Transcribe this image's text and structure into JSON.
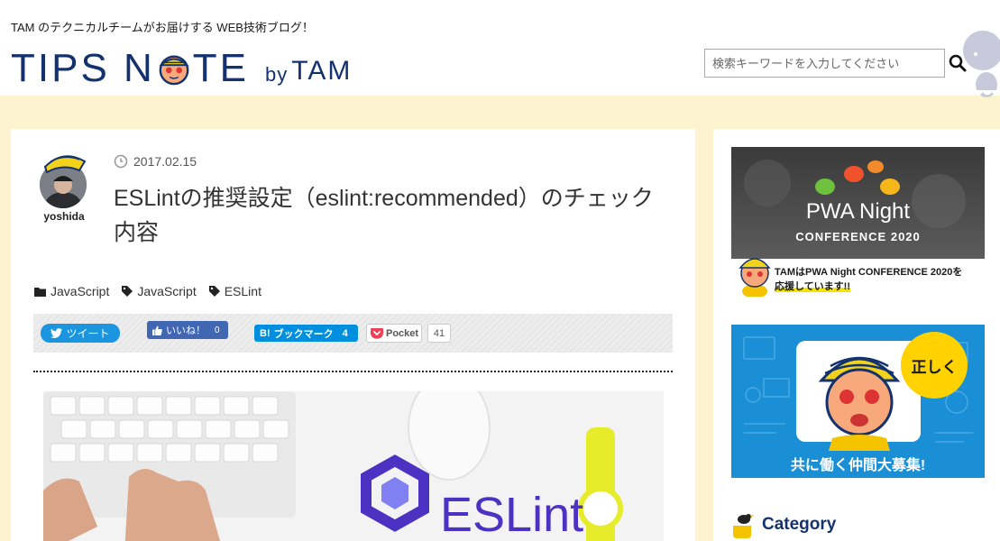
{
  "header": {
    "tagline": "TAM のテクニカルチームがお届けする WEB技術ブログ！",
    "logo_tips": "TIPS N",
    "logo_te": "TE",
    "logo_by": "by",
    "logo_tam": "TAM",
    "search_placeholder": "検索キーワードを入力してください"
  },
  "post": {
    "author_name": "yoshida",
    "date": "2017.02.15",
    "title": "ESLintの推奨設定（eslint:recommended）のチェック内容",
    "category": "JavaScript",
    "tags": [
      "JavaScript",
      "ESLint"
    ]
  },
  "share": {
    "tweet_label": "ツイート",
    "like_label": "いいね！",
    "like_count": "0",
    "hatena_label": "ブックマーク",
    "hatena_count": "4",
    "pocket_label": "Pocket",
    "pocket_count": "41"
  },
  "hero": {
    "logo_text": "ESLint"
  },
  "sidebar": {
    "pwa_title": "PWA Night",
    "pwa_subtitle": "CONFERENCE 2020",
    "pwa_message_line1": "TAMはPWA Night CONFERENCE 2020を",
    "pwa_message_line2": "応援しています!!",
    "recruit_bubble": "正しく",
    "recruit_text": "共に働く仲間大募集!",
    "category_heading": "Category"
  },
  "colors": {
    "brand_navy": "#13326e",
    "twitter": "#1b95e0",
    "facebook": "#4267b2",
    "hatena": "#008fde",
    "recruit_blue": "#1a8fd6",
    "accent_yellow": "#ffd200",
    "page_bg": "#fdf3cf"
  }
}
